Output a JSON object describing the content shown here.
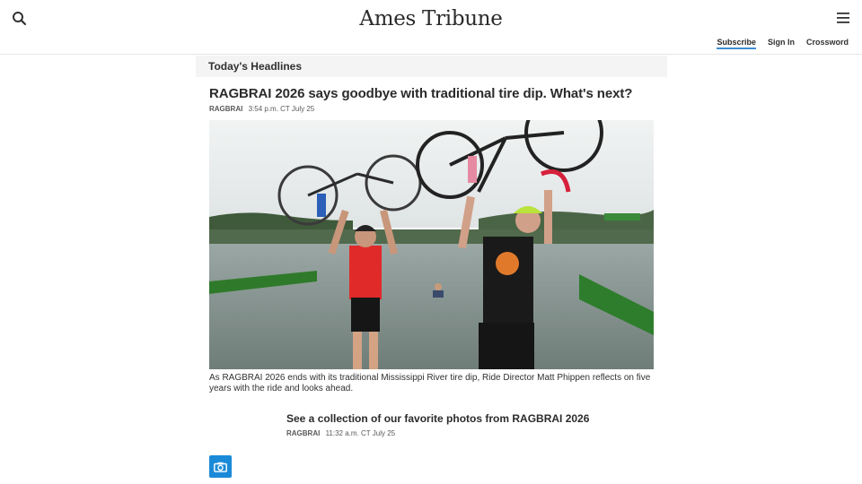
{
  "header": {
    "logo": "Ames Tribune",
    "search_icon": "search-icon",
    "menu_icon": "hamburger-menu-icon",
    "links": {
      "subscribe": "Subscribe",
      "sign_in": "Sign In",
      "crossword": "Crossword"
    },
    "accent_color": "#3f8fd5"
  },
  "section": {
    "title": "Today's Headlines"
  },
  "main_story": {
    "headline": "RAGBRAI 2026 says goodbye with traditional tire dip. What's next?",
    "source": "RAGBRAI",
    "time": "3:54 p.m. CT July 25",
    "caption": "As RAGBRAI 2026 ends with its traditional Mississippi River tire dip, Ride Director Matt Phippen reflects on five years with the ride and looks ahead."
  },
  "second_story": {
    "headline": "See a collection of our favorite photos from RAGBRAI 2026",
    "source": "RAGBRAI",
    "time": "11:32 a.m. CT July 25",
    "icon": "camera-icon",
    "icon_color": "#1a8ad8"
  }
}
